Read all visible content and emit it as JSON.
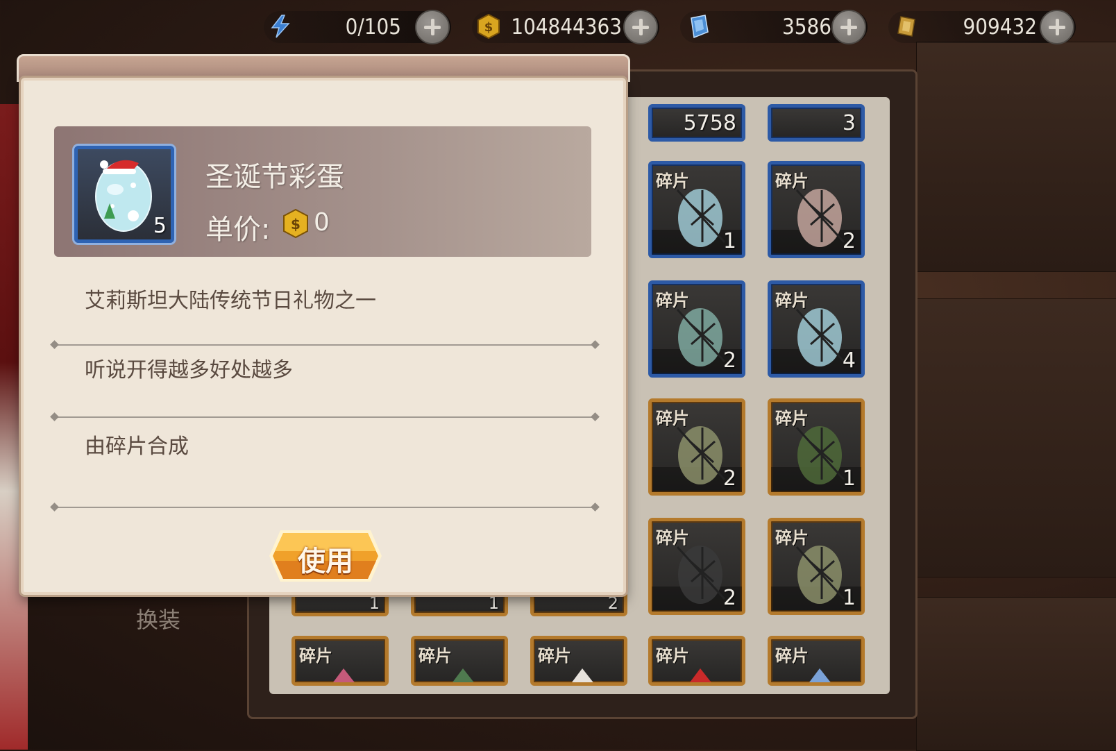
{
  "resources": [
    {
      "name": "energy",
      "icon": "lightning-icon",
      "value": "0/105"
    },
    {
      "name": "gold",
      "icon": "gold-coin-icon",
      "value": "104844363"
    },
    {
      "name": "gems",
      "icon": "blue-crystal-icon",
      "value": "3586"
    },
    {
      "name": "tokens",
      "icon": "token-icon",
      "value": "909432"
    }
  ],
  "popup": {
    "item_name": "圣诞节彩蛋",
    "item_count": "5",
    "price_label": "单价:",
    "price_value": "0",
    "descriptions": [
      "艾莉斯坦大陆传统节日礼物之一",
      "听说开得越多好处越多",
      "由碎片合成"
    ],
    "use_button": "使用"
  },
  "inventory": {
    "top_partial_counts": [
      "5758",
      "3"
    ],
    "fragment_tag": "碎片",
    "fragments": [
      {
        "count": "1",
        "frame": "blue",
        "icon": "egg-fragment-icon"
      },
      {
        "count": "2",
        "frame": "blue",
        "icon": "egg-fragment-icon"
      },
      {
        "count": "2",
        "frame": "blue",
        "icon": "egg-fragment-icon"
      },
      {
        "count": "4",
        "frame": "blue",
        "icon": "egg-fragment-icon"
      },
      {
        "count": "2",
        "frame": "gold",
        "icon": "dark-armor-fragment-icon"
      },
      {
        "count": "1",
        "frame": "gold",
        "icon": "camo-armor-fragment-icon"
      },
      {
        "count": "2",
        "frame": "gold",
        "icon": "green-blade-fragment-icon"
      },
      {
        "count": "1",
        "frame": "gold",
        "icon": "blue-red-fragment-icon"
      }
    ],
    "hidden_row_counts": [
      "1",
      "1",
      "2"
    ],
    "bottom_fragments": [
      {
        "icon": "bikini-fragment-icon"
      },
      {
        "icon": "green-cloth-fragment-icon"
      },
      {
        "icon": "white-outfit-fragment-icon"
      },
      {
        "icon": "red-ribbon-fragment-icon"
      },
      {
        "icon": "blue-outfit-fragment-icon"
      }
    ]
  },
  "side_label": "换装",
  "colors": {
    "popup_bg": "#efe6d9",
    "header_card": "#a5928c",
    "text_dark": "#5a4a40",
    "blue_frame": "#2d5aa6",
    "gold_frame": "#b47a2c",
    "button_orange": "#f0a12a"
  }
}
